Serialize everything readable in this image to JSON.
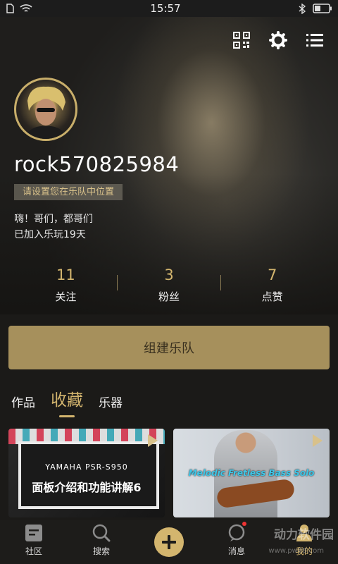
{
  "status_bar": {
    "time": "15:57"
  },
  "profile": {
    "username": "rock570825984",
    "location_prompt": "请设置您在乐队中位置",
    "bio": "嗨！哥们，都哥们",
    "joined": "已加入乐玩19天"
  },
  "stats": [
    {
      "value": "11",
      "label": "关注"
    },
    {
      "value": "3",
      "label": "粉丝"
    },
    {
      "value": "7",
      "label": "点赞"
    }
  ],
  "create_band_label": "组建乐队",
  "tabs": [
    {
      "label": "作品"
    },
    {
      "label": "收藏"
    },
    {
      "label": "乐器"
    }
  ],
  "cards": [
    {
      "line1": "YAMAHA PSR-S950",
      "line2": "面板介绍和功能讲解6"
    },
    {
      "caption": "Melodic Fretless Bass Solo"
    }
  ],
  "nav": [
    {
      "label": "社区"
    },
    {
      "label": "搜索"
    },
    {
      "label": "消息"
    },
    {
      "label": "我的"
    }
  ],
  "watermark": {
    "text": "动力软件园",
    "url": "www.pw88.com"
  },
  "colors": {
    "accent": "#d3b56e",
    "band_button": "#a6905c",
    "background": "#1b1a18"
  }
}
